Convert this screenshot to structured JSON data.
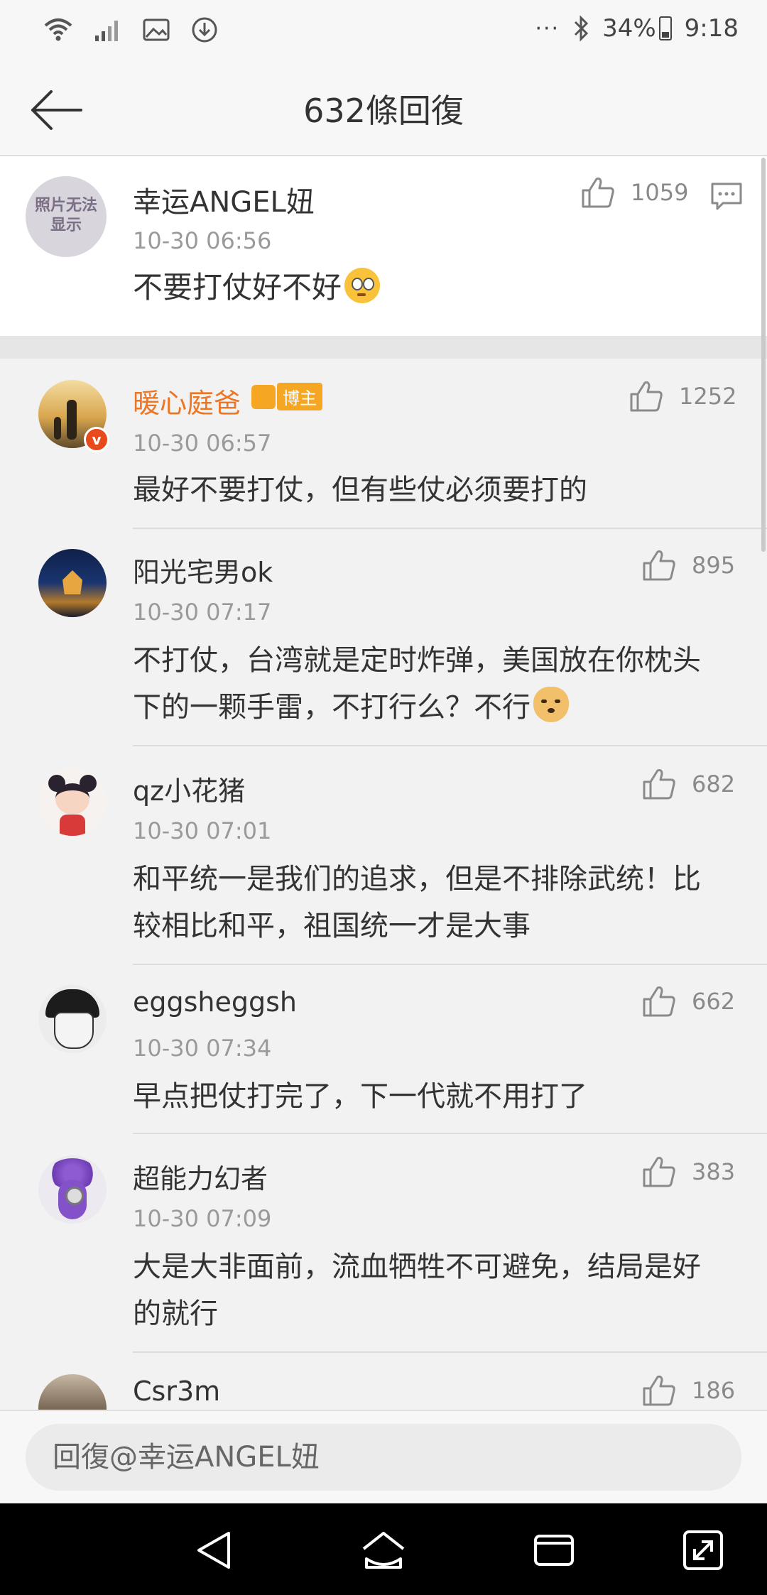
{
  "status_bar": {
    "battery": "34%",
    "time": "9:18",
    "dots": "···",
    "icons": [
      "wifi-icon",
      "signal-icon",
      "image-icon",
      "download-icon",
      "bluetooth-icon",
      "battery-icon"
    ]
  },
  "header": {
    "title": "632條回復",
    "back_icon": "back-arrow-icon"
  },
  "main_comment": {
    "username": "幸运ANGEL妞",
    "timestamp": "10-30 06:56",
    "text": "不要打仗好不好",
    "emoji": "flushed-face-emoji",
    "likes": "1059",
    "avatar_text": "照片无法显示"
  },
  "replies": [
    {
      "username": "暖心庭爸",
      "badge": "博主",
      "timestamp": "10-30 06:57",
      "lines": [
        "最好不要打仗，但有些仗必须要打的"
      ],
      "likes": "1252"
    },
    {
      "username": "阳光宅男ok",
      "timestamp": "10-30 07:17",
      "lines": [
        "不打仗，台湾就是定时炸弹，美国放在你枕头",
        "下的一颗手雷，不打行么？不行"
      ],
      "likes": "895"
    },
    {
      "username": "qz小花猪",
      "timestamp": "10-30 07:01",
      "lines": [
        "和平统一是我们的追求，但是不排除武统！比",
        "较相比和平，祖国统一才是大事"
      ],
      "likes": "682"
    },
    {
      "username": "eggsheggsh",
      "timestamp": "10-30 07:34",
      "lines": [
        "早点把仗打完了，下一代就不用打了"
      ],
      "likes": "662"
    },
    {
      "username": "超能力幻者",
      "timestamp": "10-30 07:09",
      "lines": [
        "大是大非面前，流血牺牲不可避免，结局是好",
        "的就行"
      ],
      "likes": "383"
    },
    {
      "username": "Csr3m",
      "timestamp": "",
      "lines": [],
      "likes": "186"
    }
  ],
  "reply_input": {
    "placeholder": "回復@幸运ANGEL妞"
  },
  "colors": {
    "accent_orange": "#eb7625",
    "badge_gold": "#f5a623",
    "verified_red": "#e84a1b"
  }
}
